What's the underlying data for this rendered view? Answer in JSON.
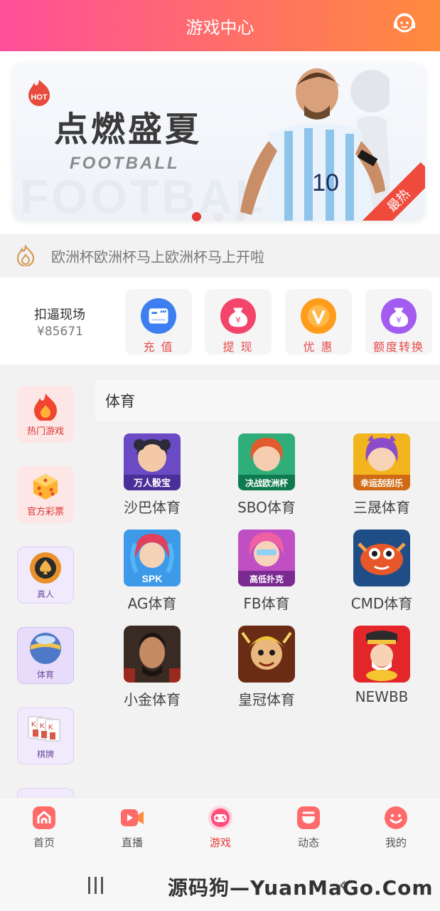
{
  "header": {
    "title": "游戏中心",
    "service_icon": "customer-service-icon"
  },
  "banner": {
    "hot_badge": "HOT",
    "title": "点燃盛夏",
    "subtitle": "FOOTBALL",
    "bg_text": "FOOTBALL",
    "player_number": "10",
    "corner_tag": "最热",
    "slides": 3,
    "active_slide": 0
  },
  "marquee": {
    "text": "欧洲杯欧洲杯马上欧洲杯马上开啦"
  },
  "wallet": {
    "name": "扣逼现场",
    "balance": "¥85671",
    "actions": [
      {
        "label": "充 值",
        "icon": "card-icon"
      },
      {
        "label": "提 现",
        "icon": "money-bag-icon"
      },
      {
        "label": "优 惠",
        "icon": "vip-icon"
      },
      {
        "label": "额度转换",
        "icon": "exchange-bag-icon"
      }
    ]
  },
  "sidebar": {
    "items": [
      {
        "label": "热门游戏",
        "icon": "fire-icon"
      },
      {
        "label": "官方彩票",
        "icon": "dice-icon"
      },
      {
        "label": "真人",
        "icon": "poker-chip-icon"
      },
      {
        "label": "体育",
        "icon": "ball-icon"
      },
      {
        "label": "棋牌",
        "icon": "cards-icon"
      }
    ]
  },
  "section": {
    "title": "体育",
    "games": [
      {
        "name": "沙巴体育",
        "tile_text": "万人骰宝"
      },
      {
        "name": "SBO体育",
        "tile_text": "决战欧洲杯"
      },
      {
        "name": "三晟体育",
        "tile_text": "幸运刮刮乐"
      },
      {
        "name": "AG体育",
        "tile_text": "SPK"
      },
      {
        "name": "FB体育",
        "tile_text": "高低扑克"
      },
      {
        "name": "CMD体育",
        "tile_text": ""
      },
      {
        "name": "小金体育",
        "tile_text": ""
      },
      {
        "name": "皇冠体育",
        "tile_text": ""
      },
      {
        "name": "NEWBB",
        "tile_text": ""
      }
    ]
  },
  "tabbar": {
    "tabs": [
      {
        "label": "首页",
        "icon": "home-icon"
      },
      {
        "label": "直播",
        "icon": "video-icon"
      },
      {
        "label": "游戏",
        "icon": "gamepad-icon"
      },
      {
        "label": "动态",
        "icon": "feed-icon"
      },
      {
        "label": "我的",
        "icon": "smile-icon"
      }
    ],
    "active": "游戏"
  },
  "watermark": "源码狗—YuanMaGo.Com",
  "colors": {
    "accent": "#ff5a7e",
    "header_end": "#ff8a3d",
    "tab_active": "#e63a3a",
    "action_label": "#e64b4b"
  }
}
